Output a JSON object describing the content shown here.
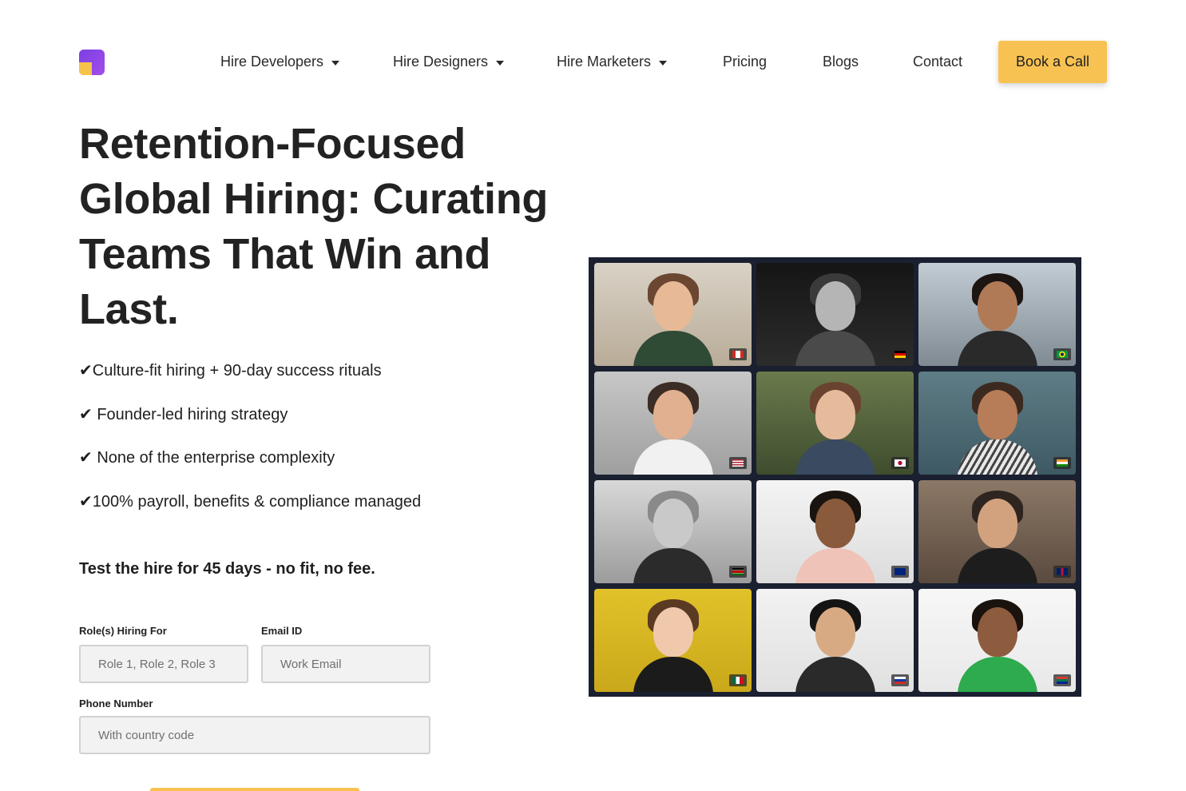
{
  "nav": {
    "items": [
      {
        "label": "Hire Developers",
        "dropdown": true
      },
      {
        "label": "Hire Designers",
        "dropdown": true
      },
      {
        "label": "Hire Marketers",
        "dropdown": true
      },
      {
        "label": "Pricing",
        "dropdown": false
      },
      {
        "label": "Blogs",
        "dropdown": false
      },
      {
        "label": "Contact",
        "dropdown": false
      }
    ],
    "cta_label": "Book a Call"
  },
  "hero": {
    "title": "Retention-Focused Global Hiring: Curating Teams That Win and Last.",
    "benefits": [
      "✔Culture-fit hiring + 90-day success rituals",
      "✔ Founder-led hiring strategy",
      "✔ None of the enterprise complexity",
      "✔100% payroll, benefits & compliance managed"
    ],
    "tagline": "Test the hire for 45 days - no fit, no fee."
  },
  "form": {
    "roles": {
      "label": "Role(s) Hiring For",
      "placeholder": "Role 1, Role 2, Role 3"
    },
    "email": {
      "label": "Email ID",
      "placeholder": "Work Email"
    },
    "phone": {
      "label": "Phone Number",
      "placeholder": "With country code"
    }
  },
  "colors": {
    "accent": "#f8c253",
    "brand_purple": "#7b3fe4",
    "text": "#1f1f1f",
    "grid_frame": "#1a2030"
  },
  "photo_grid": {
    "tiles": [
      {
        "name": "smiling-woman-curly-hair",
        "flag": "flag-canada-icon"
      },
      {
        "name": "smiling-man-bw",
        "flag": "flag-germany-icon"
      },
      {
        "name": "woman-glasses-street",
        "flag": "flag-brazil-icon"
      },
      {
        "name": "man-glasses-beard",
        "flag": "flag-usa-icon"
      },
      {
        "name": "woman-outdoors",
        "flag": "flag-japan-icon"
      },
      {
        "name": "woman-striped-jacket",
        "flag": "flag-india-icon"
      },
      {
        "name": "bearded-man-bw",
        "flag": "flag-kenya-icon"
      },
      {
        "name": "woman-whiteboard",
        "flag": "flag-australia-icon"
      },
      {
        "name": "man-turtleneck",
        "flag": "flag-uk-icon"
      },
      {
        "name": "woman-yellow-backdrop",
        "flag": "flag-mexico-icon"
      },
      {
        "name": "woman-glasses-smiling",
        "flag": "flag-russia-icon"
      },
      {
        "name": "man-green-shirt",
        "flag": "flag-south-africa-icon"
      }
    ]
  }
}
